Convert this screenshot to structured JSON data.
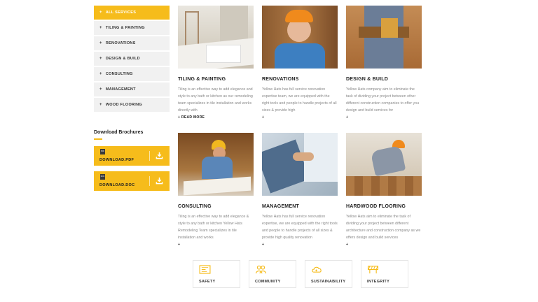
{
  "sidebar": {
    "items": [
      {
        "label": "ALL SERVICES"
      },
      {
        "label": "TILING & PAINTING"
      },
      {
        "label": "RENOVATIONS"
      },
      {
        "label": "DESIGN & BUILD"
      },
      {
        "label": "CONSULTING"
      },
      {
        "label": "MANAGEMENT"
      },
      {
        "label": "WOOD FLOORING"
      }
    ],
    "plus_icon": "+"
  },
  "brochures": {
    "title": "Download Brochures",
    "items": [
      {
        "type_badge": "PDF",
        "label": "DOWNLOAD.PDF"
      },
      {
        "type_badge": "DOC",
        "label": "DOWNLOAD.DOC"
      }
    ]
  },
  "services": [
    {
      "title": "TILING & PAINTING",
      "desc": "Tiling is an effective way to add elegance and style to any bath or kitchen as our remodeling team specializes in tile installation and works directly with",
      "more": "+ READ MORE"
    },
    {
      "title": "RENOVATIONS",
      "desc": "Yellow Hats has full service renovation expertise team, we are equipped with the right tools and people to handle projects of all sizes & provide high",
      "more": "+"
    },
    {
      "title": "DESIGN & BUILD",
      "desc": "Yellow Hats company aim to eliminate the task of dividing your project between other different construction companies to offer you design and build services for",
      "more": "+"
    },
    {
      "title": "CONSULTING",
      "desc": "Tiling is an effective way to add elegance & style to any bath or kitchen Yellow Hats Remodeling Team specializes in tile installation and works",
      "more": "+"
    },
    {
      "title": "MANAGEMENT",
      "desc": "Yellow Hats has full service renovation expertise, we are equipped with the right tools and people to handle projects of all sizes & provide high quality renovation",
      "more": "+"
    },
    {
      "title": "HARDWOOD FLOORING",
      "desc": "Yellow Hats aim to eliminate the task of dividing your project between different architecture and construction company as we offers design and build services",
      "more": "+"
    }
  ],
  "features": [
    {
      "label": "SAFETY",
      "icon": "blueprint-icon"
    },
    {
      "label": "COMMUNITY",
      "icon": "people-icon"
    },
    {
      "label": "SUSTAINABILITY",
      "icon": "eco-cloud-icon"
    },
    {
      "label": "INTEGRITY",
      "icon": "construction-barrier-icon"
    }
  ],
  "colors": {
    "accent": "#f6bc1b",
    "panel": "#f1f1f1",
    "text": "#222222",
    "muted": "#888888"
  }
}
